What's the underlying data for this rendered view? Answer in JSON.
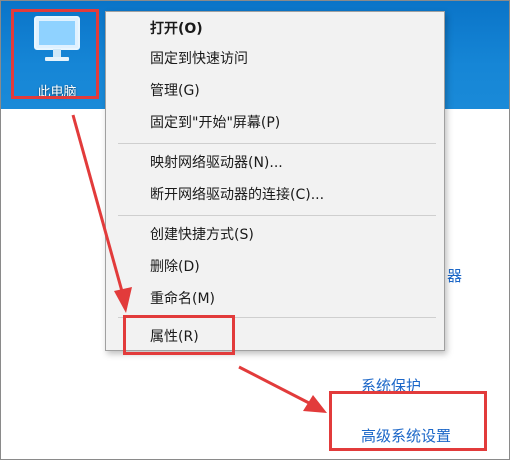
{
  "desktop": {
    "icon_label": "此电脑"
  },
  "context_menu": {
    "items": [
      {
        "label": "打开(O)"
      },
      {
        "label": "固定到快速访问"
      },
      {
        "label": "管理(G)"
      },
      {
        "label": "固定到\"开始\"屏幕(P)"
      },
      {
        "label": "映射网络驱动器(N)..."
      },
      {
        "label": "断开网络驱动器的连接(C)..."
      },
      {
        "label": "创建快捷方式(S)"
      },
      {
        "label": "删除(D)"
      },
      {
        "label": "重命名(M)"
      },
      {
        "label": "属性(R)"
      }
    ]
  },
  "system_panel": {
    "links": [
      {
        "label": "系统保护"
      },
      {
        "label": "高级系统设置"
      }
    ]
  },
  "colors": {
    "highlight_box": "#e23b3b",
    "arrow": "#e23b3b",
    "link": "#1c67c8",
    "desktop": "#1686d6"
  }
}
